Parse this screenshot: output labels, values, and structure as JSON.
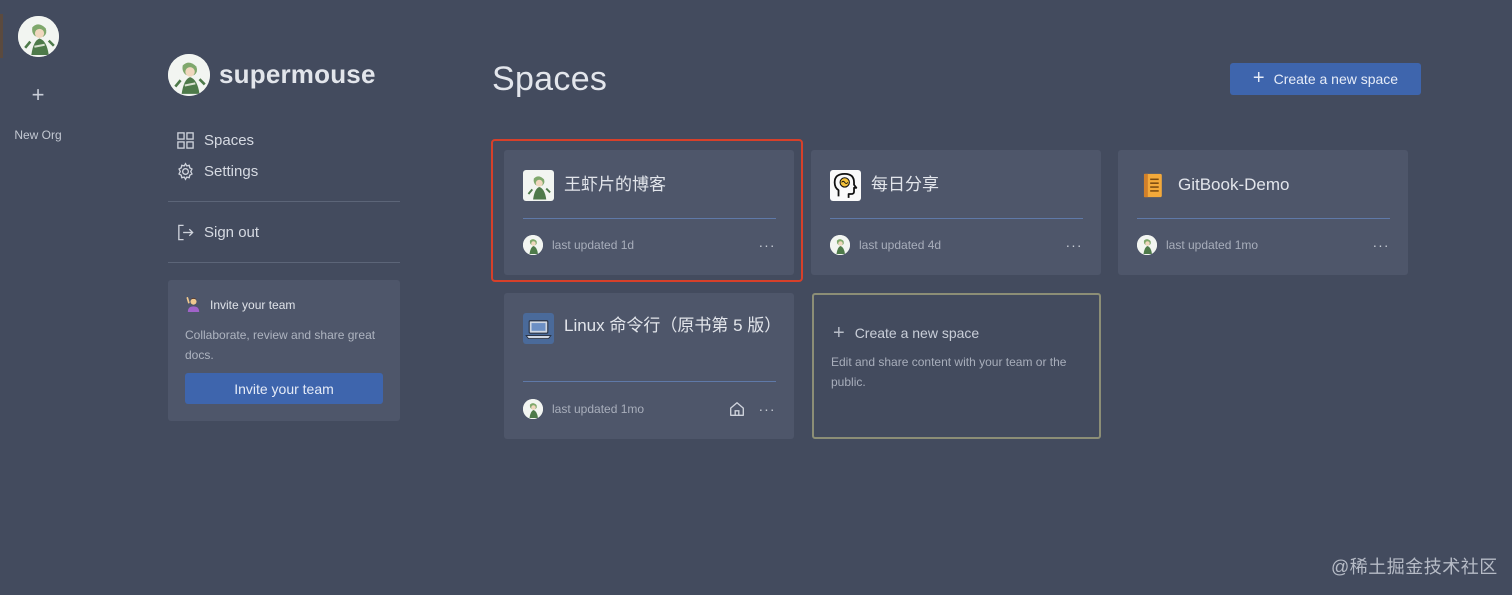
{
  "org_rail": {
    "new_org_plus": "+",
    "new_org_label": "New Org"
  },
  "sidebar": {
    "org_name": "supermouse",
    "nav": [
      {
        "label": "Spaces",
        "icon": "grid-icon"
      },
      {
        "label": "Settings",
        "icon": "gear-icon"
      }
    ],
    "sign_out": "Sign out",
    "invite": {
      "title": "Invite your team",
      "description": "Collaborate, review and share great docs.",
      "button": "Invite your team"
    }
  },
  "main": {
    "title": "Spaces",
    "create_button": "Create a new space",
    "create_plus": "+",
    "spaces": [
      {
        "name": "王虾片的博客",
        "updated": "last updated 1d",
        "icon": "avatar-icon",
        "more": "···",
        "selected": true
      },
      {
        "name": "每日分享",
        "updated": "last updated 4d",
        "icon": "thinking-head-icon",
        "more": "···"
      },
      {
        "name": "GitBook-Demo",
        "updated": "last updated 1mo",
        "icon": "notebook-icon",
        "more": "···"
      },
      {
        "name": "Linux 命令行（原书第 5 版）",
        "updated": "last updated 1mo",
        "icon": "laptop-icon",
        "more": "···",
        "home": true
      }
    ],
    "new_space_card": {
      "plus": "+",
      "title": "Create a new space",
      "description": "Edit and share content with your team or the public."
    }
  },
  "colors": {
    "background": "#434b5e",
    "card": "#4e566a",
    "accent": "#3e65ad",
    "highlight": "#d6402a"
  },
  "watermark": "@稀土掘金技术社区"
}
